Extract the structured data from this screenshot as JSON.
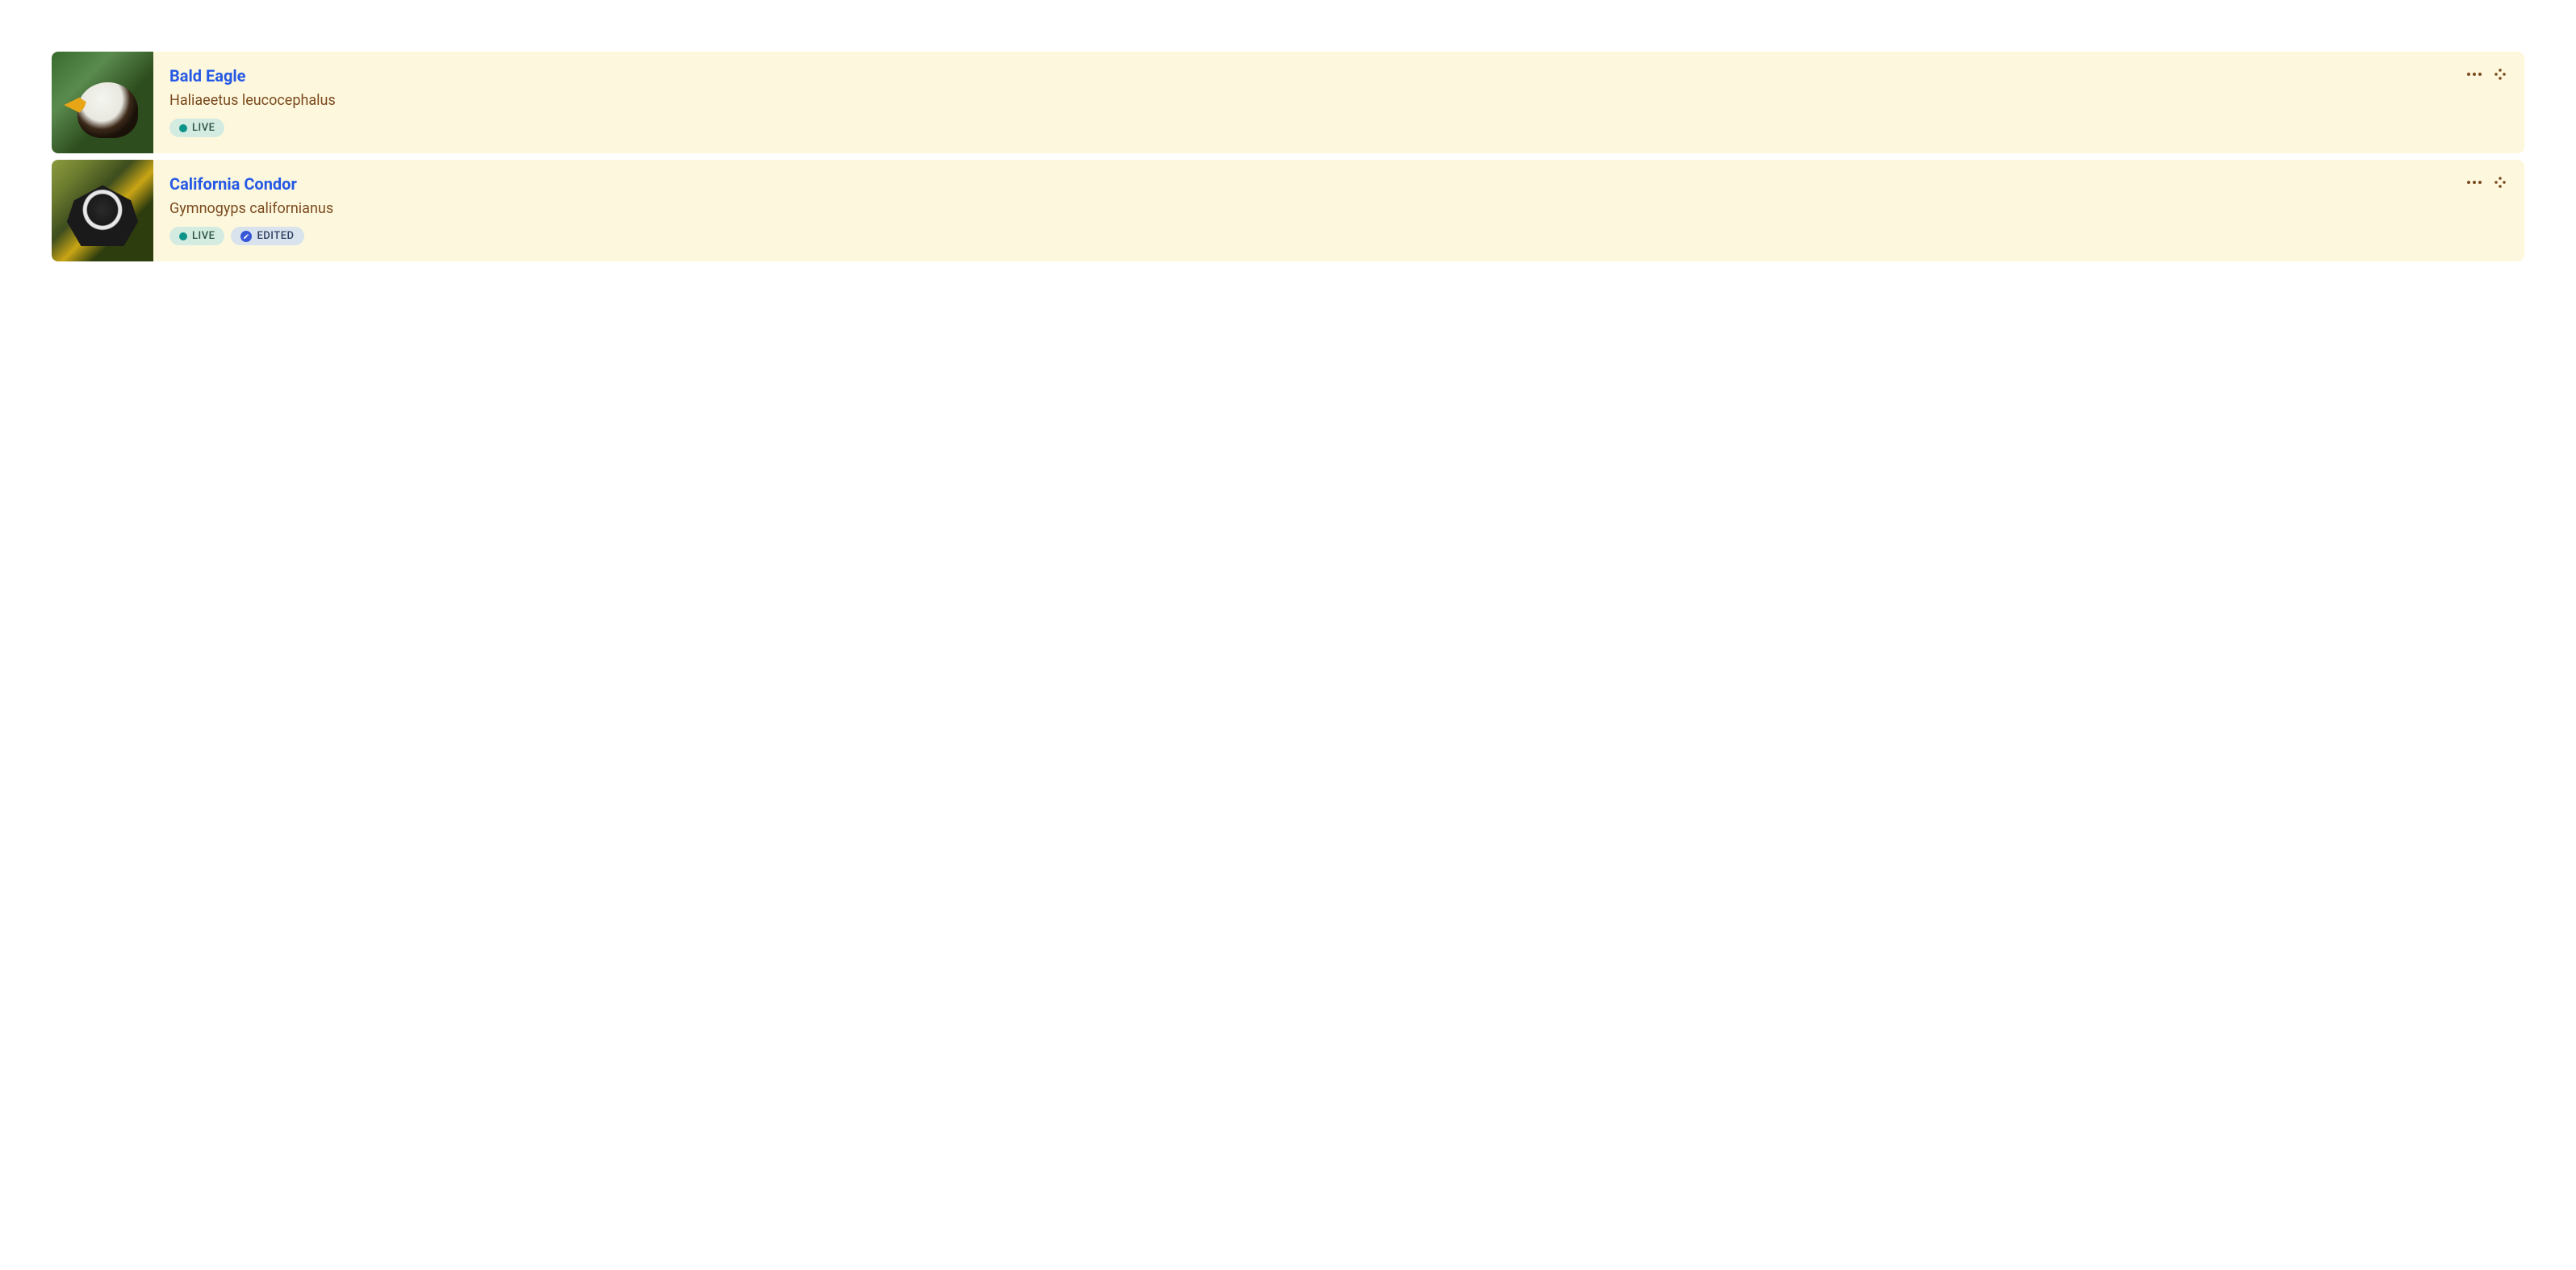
{
  "badge_labels": {
    "live": "LIVE",
    "edited": "EDITED"
  },
  "items": [
    {
      "title": "Bald Eagle",
      "subtitle": "Haliaeetus leucocephalus",
      "image_alt": "Bald Eagle photograph",
      "badges": [
        "live"
      ]
    },
    {
      "title": "California Condor",
      "subtitle": "Gymnogyps californianus",
      "image_alt": "California Condor photograph",
      "badges": [
        "live",
        "edited"
      ]
    }
  ]
}
